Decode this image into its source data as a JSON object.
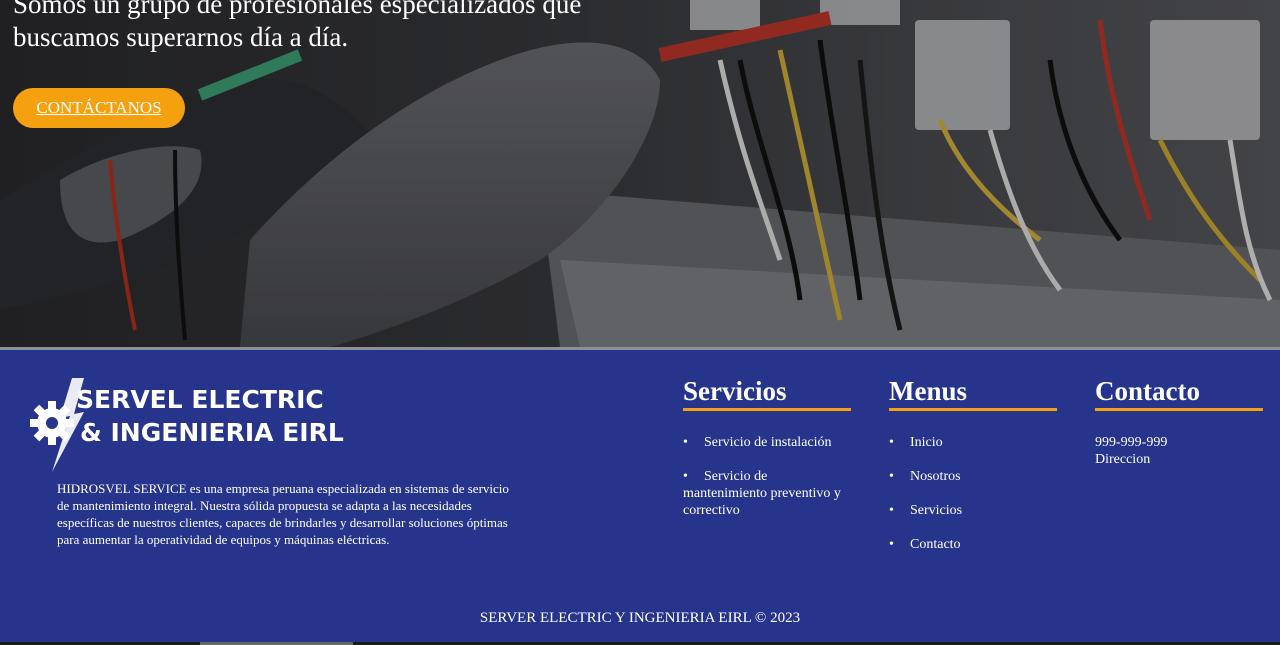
{
  "hero": {
    "tagline": "Somos un grupo de profesionales especializados que buscamos superarnos día a día.",
    "cta_label": "CONTÁCTANOS"
  },
  "footer": {
    "logo_text_line1": "SERVEL ELECTRIC",
    "logo_text_line2": "& INGENIERIA EIRL",
    "about": "HIDROSVEL SERVICE es una empresa peruana especializada en sistemas de servicio de mantenimiento integral. Nuestra sólida propuesta se adapta a las necesidades específicas de nuestros clientes, capaces de brindarles y desarrollar soluciones óptimas para aumentar la operatividad de equipos y máquinas eléctricas.",
    "servicios": {
      "title": "Servicios",
      "items": [
        "Servicio de instalación",
        "Servicio de mantenimiento preventivo y correctivo"
      ]
    },
    "menus": {
      "title": "Menus",
      "items": [
        "Inicio",
        "Nosotros",
        "Servicios",
        "Contacto"
      ]
    },
    "contacto": {
      "title": "Contacto",
      "phone": "999-999-999",
      "address": "Direccion"
    },
    "copyright": "SERVER ELECTRIC Y INGENIERIA EIRL © 2023"
  },
  "colors": {
    "accent": "#f5a00f",
    "footer_bg": "#27348b"
  }
}
